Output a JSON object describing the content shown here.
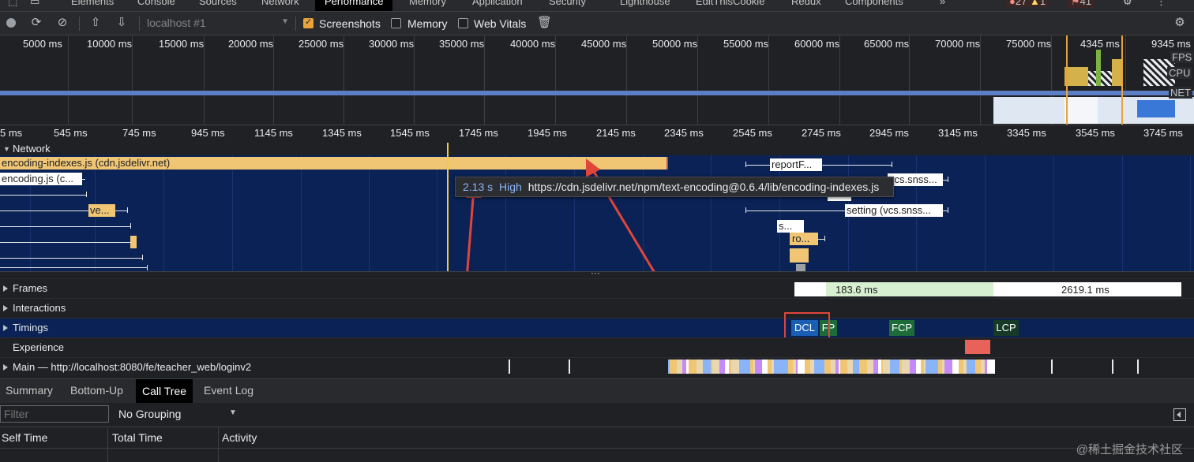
{
  "devtools": {
    "tabs": [
      "Elements",
      "Console",
      "Sources",
      "Network",
      "Performance",
      "Memory",
      "Application",
      "Security",
      "Lighthouse",
      "EditThisCookie",
      "Redux",
      "Components",
      "»"
    ],
    "active_tab": "Performance",
    "badges": {
      "errors": "27",
      "warnings": "1",
      "issues": "41"
    }
  },
  "toolbar": {
    "target_select": "localhost #1",
    "screenshots_label": "Screenshots",
    "screenshots_checked": true,
    "memory_label": "Memory",
    "memory_checked": false,
    "web_vitals_label": "Web Vitals",
    "web_vitals_checked": false
  },
  "overview": {
    "ticks": [
      "5000 ms",
      "10000 ms",
      "15000 ms",
      "20000 ms",
      "25000 ms",
      "30000 ms",
      "35000 ms",
      "40000 ms",
      "45000 ms",
      "50000 ms",
      "55000 ms",
      "60000 ms",
      "65000 ms",
      "70000 ms",
      "75000 ms",
      "4345 ms",
      "9345 ms"
    ],
    "lane_labels": [
      "FPS",
      "CPU",
      "NET"
    ]
  },
  "ruler": {
    "ticks": [
      "5 ms",
      "545 ms",
      "745 ms",
      "945 ms",
      "1145 ms",
      "1345 ms",
      "1545 ms",
      "1745 ms",
      "1945 ms",
      "2145 ms",
      "2345 ms",
      "2545 ms",
      "2745 ms",
      "2945 ms",
      "3145 ms",
      "3345 ms",
      "3545 ms",
      "3745 ms"
    ]
  },
  "network": {
    "title": "Network",
    "requests": [
      {
        "label": "encoding-indexes.js (cdn.jsdelivr.net)"
      },
      {
        "label": "encoding.js (c..."
      },
      {
        "label": "ve..."
      },
      {
        "label": "reportF..."
      },
      {
        "label": "vcs.snss..."
      },
      {
        "label": "setting (vcs.snss..."
      },
      {
        "label": "s..."
      },
      {
        "label": "ro..."
      }
    ]
  },
  "tooltip": {
    "duration": "2.13 s",
    "priority": "High",
    "url": "https://cdn.jsdelivr.net/npm/text-encoding@0.6.4/lib/encoding-indexes.js"
  },
  "tracks": {
    "frames": {
      "label": "Frames",
      "values": [
        "183.6 ms",
        "2619.1 ms"
      ]
    },
    "interactions": {
      "label": "Interactions"
    },
    "timings": {
      "label": "Timings",
      "markers": [
        "DCL",
        "FP",
        "FCP",
        "LCP"
      ]
    },
    "experience": {
      "label": "Experience"
    },
    "main": {
      "label": "Main — http://localhost:8080/fe/teacher_web/loginv2"
    }
  },
  "bottom": {
    "tabs": [
      "Summary",
      "Bottom-Up",
      "Call Tree",
      "Event Log"
    ],
    "active_tab": "Call Tree",
    "filter_placeholder": "Filter",
    "grouping": "No Grouping",
    "columns": [
      "Self Time",
      "Total Time",
      "Activity"
    ]
  },
  "watermark": "@稀土掘金技术社区",
  "colors": {
    "accent": "#e8a33d",
    "request_bar": "#f0c674",
    "timings_dcl": "#1a5fb4",
    "timings_paint": "#1e6b3a",
    "annotation_red": "#e0453a"
  }
}
